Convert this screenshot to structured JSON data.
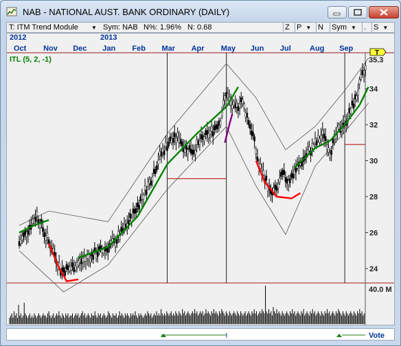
{
  "window": {
    "title": "NAB - NATIONAL AUST. BANK  ORDINARY (DAILY)"
  },
  "toolbar": {
    "module_label": "T: ITM Trend Module",
    "sym_info": "Sym: NAB",
    "pct_info": "N%: 1.96%",
    "n_info": "N: 0.68",
    "btn_z": "Z",
    "btn_p": "P",
    "btn_n": "N",
    "btn_sym": "Sym",
    "btn_dot": ".",
    "btn_s": "S"
  },
  "colors": {
    "ma_line": "#008000",
    "down_line": "#ff0000",
    "purple_line": "#800080",
    "price_bar": "#000000",
    "hline": "#b00000"
  },
  "chart_data": {
    "type": "line",
    "title": "",
    "indicator_label": "ITL (5, 2, -1)",
    "year_labels": [
      "2012",
      "2013"
    ],
    "months": [
      "Oct",
      "Nov",
      "Dec",
      "Jan",
      "Feb",
      "Mar",
      "Apr",
      "May",
      "Jun",
      "Jul",
      "Aug",
      "Sep"
    ],
    "y_ticks": [
      24,
      26,
      28,
      30,
      32,
      34
    ],
    "current_price_label": "35.3",
    "current_price": 35.3,
    "price_flag": "T",
    "ylim": [
      23.2,
      36.0
    ],
    "volume_label": "40.0 M",
    "vote_label": "Vote",
    "price_path": [
      {
        "m": 0.0,
        "v": 25.4
      },
      {
        "m": 0.3,
        "v": 26.2
      },
      {
        "m": 0.6,
        "v": 27.0
      },
      {
        "m": 0.9,
        "v": 25.8
      },
      {
        "m": 1.2,
        "v": 24.8
      },
      {
        "m": 1.4,
        "v": 23.9
      },
      {
        "m": 1.7,
        "v": 24.0
      },
      {
        "m": 2.0,
        "v": 24.3
      },
      {
        "m": 2.4,
        "v": 24.7
      },
      {
        "m": 2.8,
        "v": 25.0
      },
      {
        "m": 3.2,
        "v": 25.4
      },
      {
        "m": 3.6,
        "v": 26.3
      },
      {
        "m": 4.0,
        "v": 27.5
      },
      {
        "m": 4.4,
        "v": 28.8
      },
      {
        "m": 4.8,
        "v": 30.4
      },
      {
        "m": 5.1,
        "v": 31.1
      },
      {
        "m": 5.4,
        "v": 31.3
      },
      {
        "m": 5.6,
        "v": 30.7
      },
      {
        "m": 5.9,
        "v": 30.6
      },
      {
        "m": 6.2,
        "v": 31.2
      },
      {
        "m": 6.5,
        "v": 31.6
      },
      {
        "m": 6.8,
        "v": 32.3
      },
      {
        "m": 7.0,
        "v": 33.8
      },
      {
        "m": 7.1,
        "v": 33.3
      },
      {
        "m": 7.3,
        "v": 32.8
      },
      {
        "m": 7.5,
        "v": 33.4
      },
      {
        "m": 7.7,
        "v": 32.5
      },
      {
        "m": 7.9,
        "v": 31.4
      },
      {
        "m": 8.1,
        "v": 29.7
      },
      {
        "m": 8.3,
        "v": 29.1
      },
      {
        "m": 8.5,
        "v": 28.1
      },
      {
        "m": 8.7,
        "v": 28.4
      },
      {
        "m": 8.9,
        "v": 29.2
      },
      {
        "m": 9.1,
        "v": 28.9
      },
      {
        "m": 9.4,
        "v": 29.6
      },
      {
        "m": 9.7,
        "v": 30.3
      },
      {
        "m": 10.0,
        "v": 30.9
      },
      {
        "m": 10.3,
        "v": 31.5
      },
      {
        "m": 10.5,
        "v": 30.5
      },
      {
        "m": 10.8,
        "v": 31.7
      },
      {
        "m": 11.1,
        "v": 32.4
      },
      {
        "m": 11.4,
        "v": 33.6
      },
      {
        "m": 11.6,
        "v": 34.7
      },
      {
        "m": 11.75,
        "v": 35.3
      }
    ],
    "ma_series": [
      {
        "name": "ma-green-1",
        "color": "#008000",
        "points": [
          {
            "m": 0.0,
            "v": 26.0
          },
          {
            "m": 0.5,
            "v": 26.4
          },
          {
            "m": 1.0,
            "v": 26.7
          }
        ]
      },
      {
        "name": "ma-green-2",
        "color": "#008000",
        "points": [
          {
            "m": 2.0,
            "v": 24.6
          },
          {
            "m": 3.0,
            "v": 25.2
          },
          {
            "m": 4.0,
            "v": 26.9
          },
          {
            "m": 5.0,
            "v": 29.8
          },
          {
            "m": 6.0,
            "v": 31.5
          },
          {
            "m": 7.0,
            "v": 33.0
          },
          {
            "m": 7.4,
            "v": 34.1
          }
        ]
      },
      {
        "name": "ma-green-3",
        "color": "#008000",
        "points": [
          {
            "m": 9.3,
            "v": 29.6
          },
          {
            "m": 10.0,
            "v": 30.7
          },
          {
            "m": 10.5,
            "v": 31.1
          },
          {
            "m": 11.0,
            "v": 32.0
          },
          {
            "m": 11.5,
            "v": 33.1
          },
          {
            "m": 11.8,
            "v": 34.1
          }
        ]
      },
      {
        "name": "ma-red-1",
        "color": "#ff0000",
        "points": [
          {
            "m": 1.0,
            "v": 25.4
          },
          {
            "m": 1.3,
            "v": 24.2
          },
          {
            "m": 1.6,
            "v": 23.3
          },
          {
            "m": 2.0,
            "v": 23.4
          }
        ]
      },
      {
        "name": "ma-red-2",
        "color": "#ff0000",
        "points": [
          {
            "m": 8.0,
            "v": 30.0
          },
          {
            "m": 8.3,
            "v": 28.8
          },
          {
            "m": 8.7,
            "v": 28.0
          },
          {
            "m": 9.2,
            "v": 27.9
          },
          {
            "m": 9.5,
            "v": 28.2
          }
        ]
      },
      {
        "name": "ma-purple",
        "color": "#800080",
        "points": [
          {
            "m": 6.95,
            "v": 31.0
          },
          {
            "m": 7.1,
            "v": 32.0
          },
          {
            "m": 7.2,
            "v": 32.6
          }
        ]
      }
    ],
    "envelope_series": [
      {
        "name": "upper-band",
        "points": [
          {
            "m": 0.0,
            "v": 26.4
          },
          {
            "m": 1.0,
            "v": 27.2
          },
          {
            "m": 3.0,
            "v": 26.6
          },
          {
            "m": 5.0,
            "v": 31.5
          },
          {
            "m": 7.0,
            "v": 35.4
          },
          {
            "m": 8.0,
            "v": 33.5
          },
          {
            "m": 9.0,
            "v": 30.6
          },
          {
            "m": 10.0,
            "v": 31.9
          },
          {
            "m": 11.0,
            "v": 33.9
          },
          {
            "m": 11.8,
            "v": 35.7
          }
        ]
      },
      {
        "name": "lower-band",
        "points": [
          {
            "m": 0.0,
            "v": 25.0
          },
          {
            "m": 1.5,
            "v": 22.7
          },
          {
            "m": 3.0,
            "v": 24.2
          },
          {
            "m": 5.0,
            "v": 28.4
          },
          {
            "m": 7.0,
            "v": 31.9
          },
          {
            "m": 8.0,
            "v": 28.6
          },
          {
            "m": 9.0,
            "v": 25.9
          },
          {
            "m": 10.0,
            "v": 29.7
          },
          {
            "m": 11.0,
            "v": 31.6
          },
          {
            "m": 11.8,
            "v": 33.2
          }
        ]
      }
    ],
    "horizontal_levels": [
      {
        "m_start": 5.0,
        "m_end": 7.0,
        "v": 29.0
      },
      {
        "m_start": 11.0,
        "m_end": 11.7,
        "v": 30.9
      }
    ],
    "vertical_markers": [
      5.0,
      7.0,
      11.0
    ],
    "volume": [
      3,
      4,
      5,
      3,
      6,
      4,
      5,
      3,
      9,
      4,
      5,
      3,
      4,
      10,
      5,
      4,
      3,
      4,
      5,
      3,
      4,
      3,
      5,
      4,
      3,
      4,
      5,
      4,
      3,
      4,
      5,
      4,
      4,
      3,
      5,
      6,
      4,
      3,
      4,
      5,
      3,
      4,
      5,
      4,
      6,
      4,
      3,
      5,
      4,
      3,
      5,
      4,
      5,
      3,
      4,
      4,
      5,
      3,
      4,
      5,
      4,
      5,
      3,
      4,
      5,
      6,
      4,
      5,
      3,
      4,
      5,
      4,
      3,
      5,
      4,
      4,
      6,
      4,
      3,
      5,
      4,
      5,
      3,
      4,
      5,
      4,
      3,
      4,
      6,
      5,
      4,
      3,
      5,
      4,
      4,
      5,
      3,
      4,
      6,
      4,
      5,
      4,
      3,
      5,
      4,
      5,
      4,
      3,
      5,
      4,
      5,
      4,
      6,
      4,
      3,
      5,
      4,
      5,
      4,
      3,
      4,
      5,
      4,
      6,
      5,
      4,
      5,
      3,
      4,
      5,
      4,
      6,
      4,
      5,
      4,
      7,
      5,
      4,
      5,
      4,
      6,
      5,
      4,
      5,
      6,
      4,
      5,
      4,
      6,
      5,
      4,
      6,
      5,
      4,
      7,
      5,
      6,
      4,
      5,
      6,
      5,
      4,
      5,
      6,
      5,
      7,
      5,
      6,
      4,
      5,
      6,
      5,
      6,
      4,
      5,
      7,
      5,
      6,
      5,
      4,
      6,
      5,
      7,
      5,
      6,
      5,
      4,
      6,
      5,
      7,
      6,
      5,
      4,
      6,
      5,
      4,
      6,
      5,
      4,
      5,
      6,
      5,
      4,
      6,
      5,
      4,
      6,
      5,
      4,
      5,
      6,
      4,
      5,
      6,
      5,
      4,
      6,
      5,
      7,
      5,
      6,
      4,
      5,
      6,
      5,
      7,
      6,
      5,
      18,
      6,
      5,
      7,
      5,
      6,
      4,
      8,
      6,
      5,
      7,
      5,
      6,
      5,
      4,
      6,
      5,
      4,
      5,
      6,
      5,
      4,
      6,
      5,
      7,
      5,
      6,
      4,
      5,
      6,
      5,
      4,
      6,
      5,
      7,
      4,
      5,
      6,
      5,
      4,
      6,
      5,
      7,
      5,
      6,
      4,
      5,
      6,
      5,
      4,
      6,
      5,
      4,
      6,
      5,
      7,
      5,
      6,
      4,
      5,
      6,
      5,
      4,
      6,
      5,
      7,
      6,
      5,
      4,
      6,
      5,
      4,
      6,
      5,
      4,
      5,
      6,
      5,
      4,
      6,
      5,
      4,
      6,
      5,
      7,
      5,
      6,
      4,
      5
    ]
  }
}
